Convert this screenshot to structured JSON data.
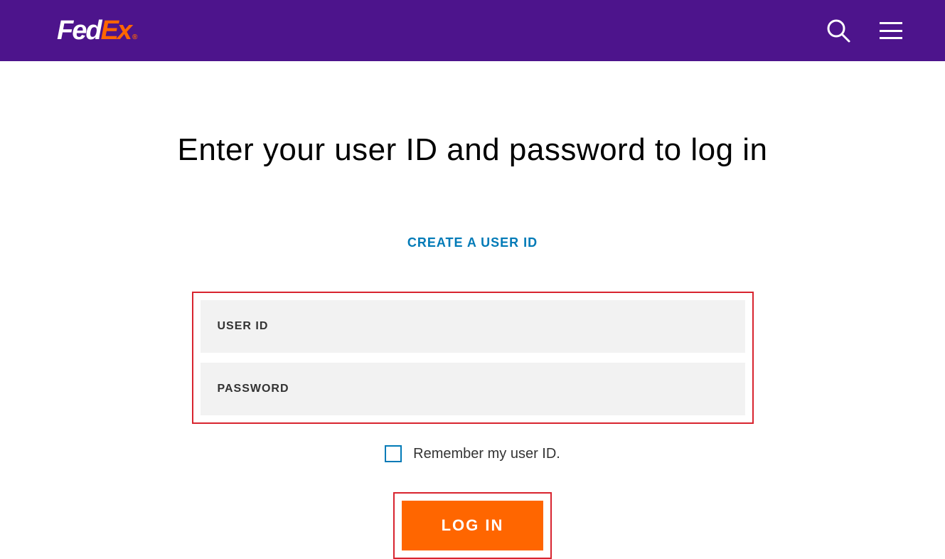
{
  "header": {
    "logo_fed": "Fed",
    "logo_ex": "Ex",
    "logo_dot": "®"
  },
  "main": {
    "title": "Enter your user ID and password to log in",
    "create_link": "CREATE A USER ID",
    "userid_placeholder": "USER ID",
    "password_placeholder": "PASSWORD",
    "remember_label": "Remember my user ID.",
    "login_button": "LOG IN"
  }
}
